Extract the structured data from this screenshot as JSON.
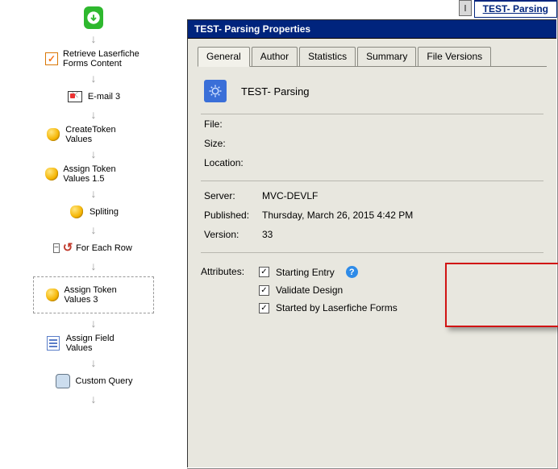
{
  "topright": {
    "active_tab": "TEST- Parsing"
  },
  "flow": {
    "nodes": {
      "retrieve": "Retrieve Laserfiche Forms Content",
      "email": "E-mail 3",
      "create_token": "CreateToken Values",
      "assign_token_15": "Assign Token Values 1.5",
      "spliting": "Spliting",
      "for_each": "For Each Row",
      "assign_token_3": "Assign Token Values 3",
      "assign_field": "Assign Field Values",
      "custom_query": "Custom Query"
    }
  },
  "props": {
    "title": "TEST- Parsing Properties",
    "tabs": [
      "General",
      "Author",
      "Statistics",
      "Summary",
      "File Versions"
    ],
    "active_tab": "General",
    "doc_title": "TEST- Parsing",
    "file": "",
    "size": "",
    "location": "",
    "server": "MVC-DEVLF",
    "published": "Thursday, March 26, 2015 4:42 PM",
    "version": "33",
    "labels": {
      "file": "File:",
      "size": "Size:",
      "location": "Location:",
      "server": "Server:",
      "published": "Published:",
      "version": "Version:",
      "attributes": "Attributes:"
    },
    "attributes": {
      "starting_entry": {
        "label": "Starting Entry",
        "checked": true
      },
      "validate_design": {
        "label": "Validate Design",
        "checked": true
      },
      "started_by_forms": {
        "label": "Started by Laserfiche Forms",
        "checked": true
      }
    }
  }
}
